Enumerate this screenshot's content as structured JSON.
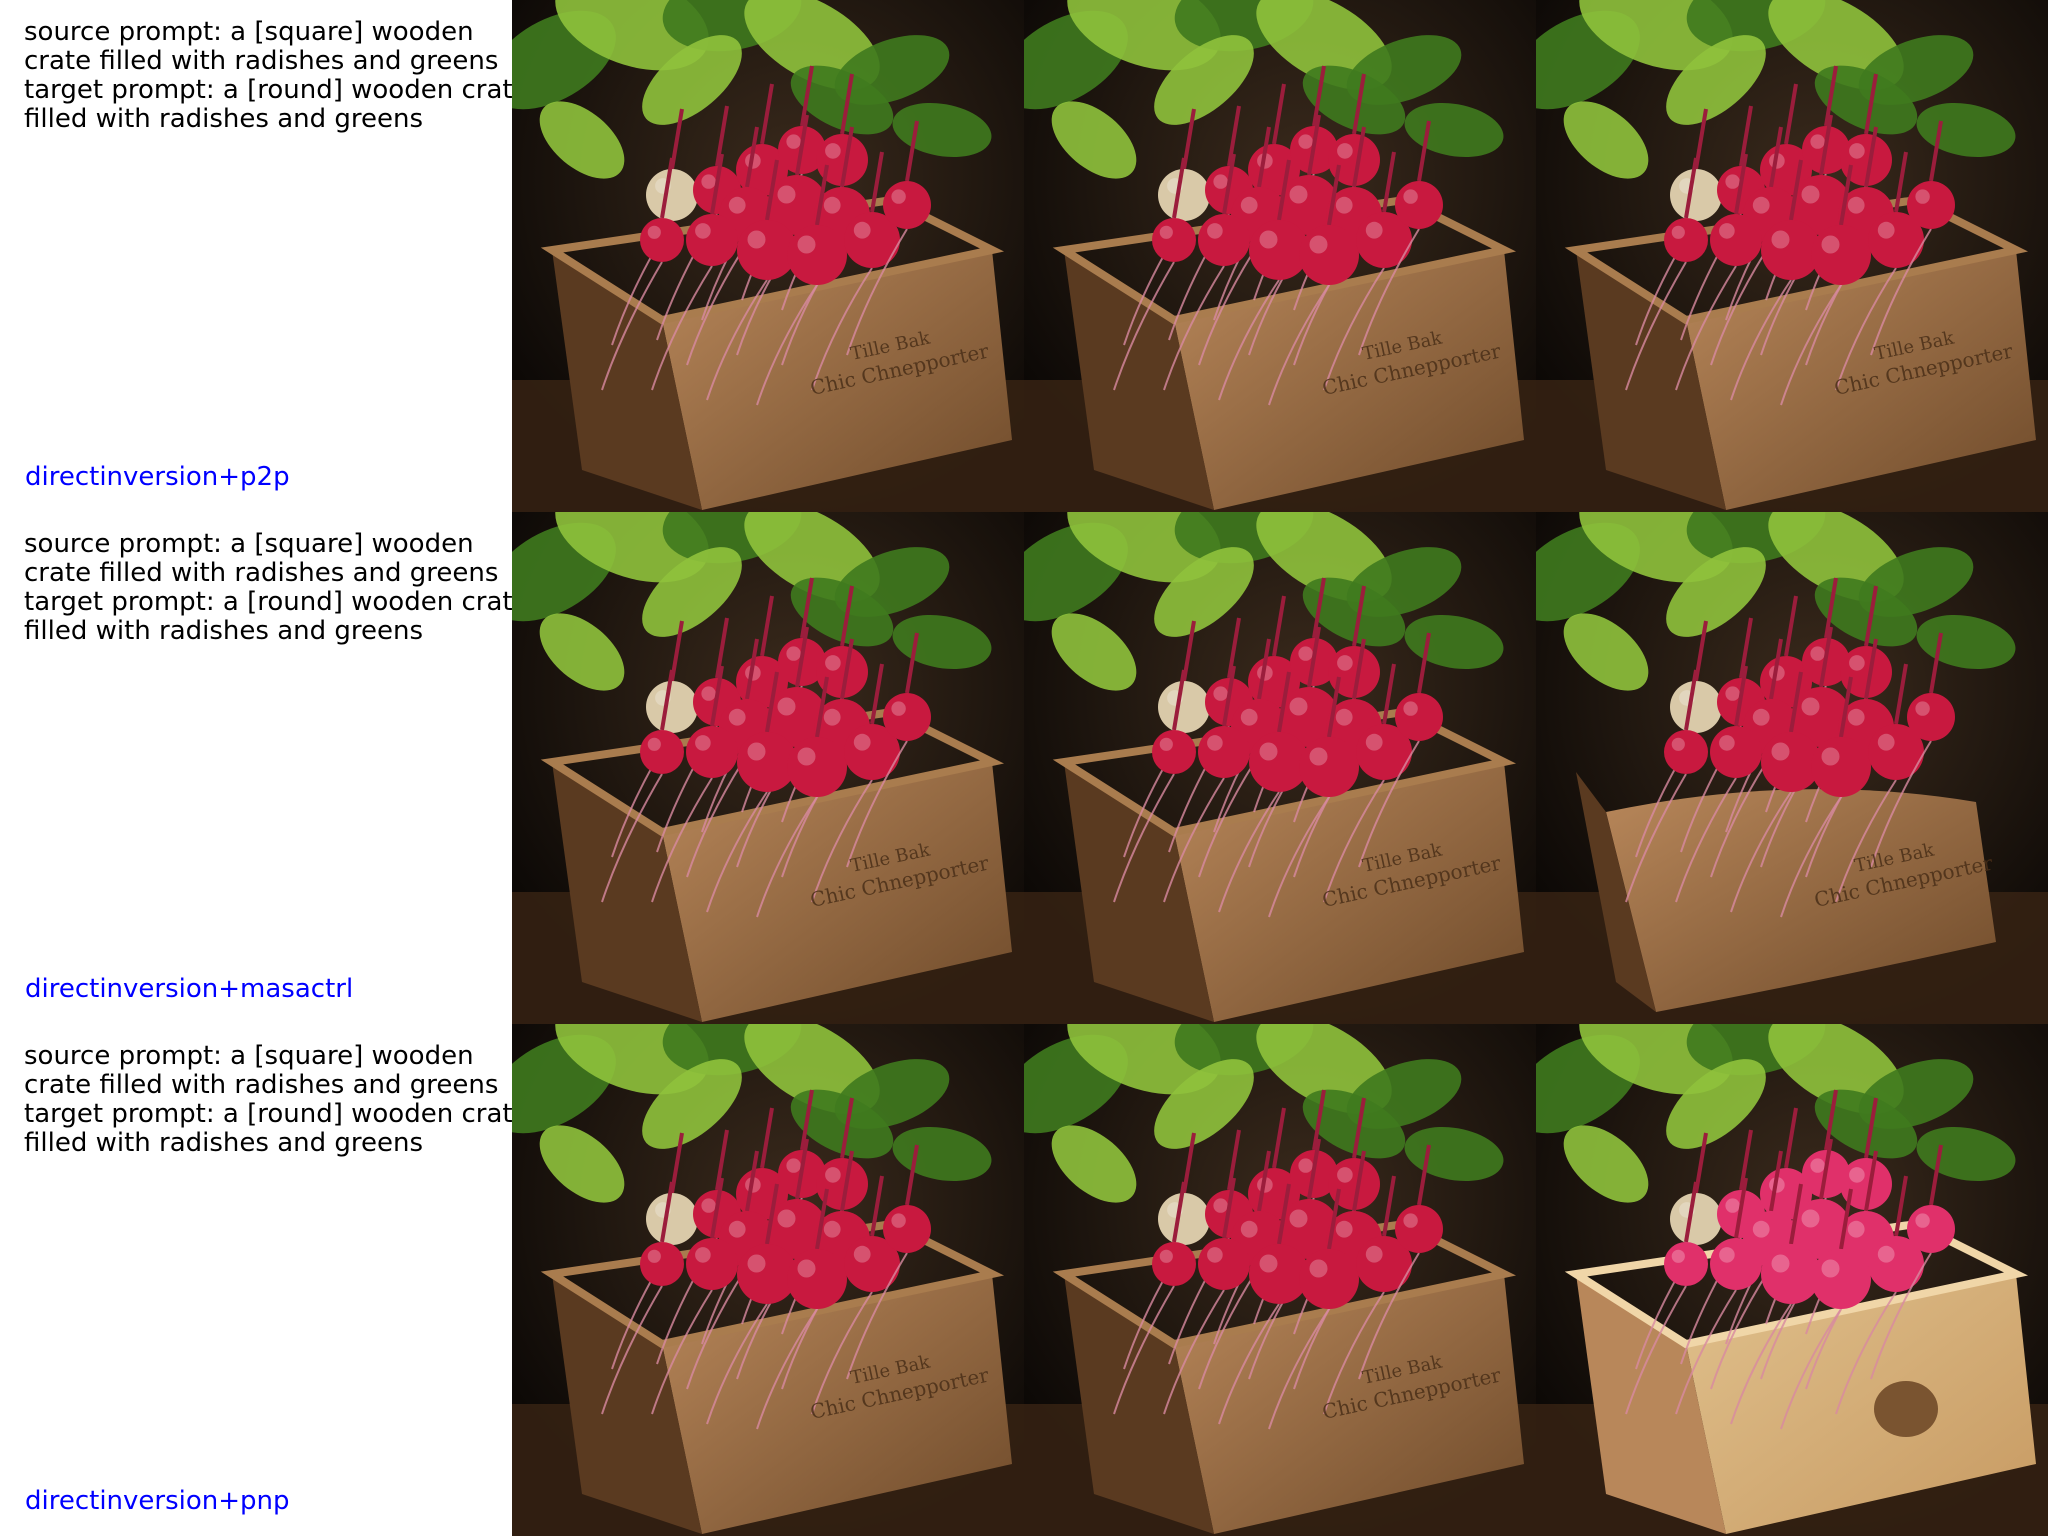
{
  "rows": [
    {
      "source_prompt": "source prompt: a [square] wooden",
      "source_prompt_cont": "crate filled with radishes and greens",
      "target_prompt": "target prompt: a [round] wooden crate",
      "target_prompt_cont": "filled with radishes and greens",
      "method": "directinversion+p2p",
      "method_color": "#0000ff"
    },
    {
      "source_prompt": "source prompt: a [square] wooden",
      "source_prompt_cont": "crate filled with radishes and greens",
      "target_prompt": "target prompt: a [round] wooden crate",
      "target_prompt_cont": "filled with radishes and greens",
      "method": "directinversion+masactrl",
      "method_color": "#0000ff"
    },
    {
      "source_prompt": "source prompt: a [square] wooden",
      "source_prompt_cont": "crate filled with radishes and greens",
      "target_prompt": "target prompt: a [round] wooden crate",
      "target_prompt_cont": "filled with radishes and greens",
      "method": "directinversion+pnp",
      "method_color": "#0000ff"
    }
  ],
  "crate_text_line1": "Tille Bak",
  "crate_text_line2": "Chic Chnepporter",
  "colors": {
    "background": "#0a0705",
    "crate_wood": "#b8875a",
    "crate_light": "#e0c08c",
    "radish": "#c8193f",
    "radish_pink": "#e0306a",
    "leaf": "#3f7a1e",
    "leaf_light": "#8fc23c"
  }
}
